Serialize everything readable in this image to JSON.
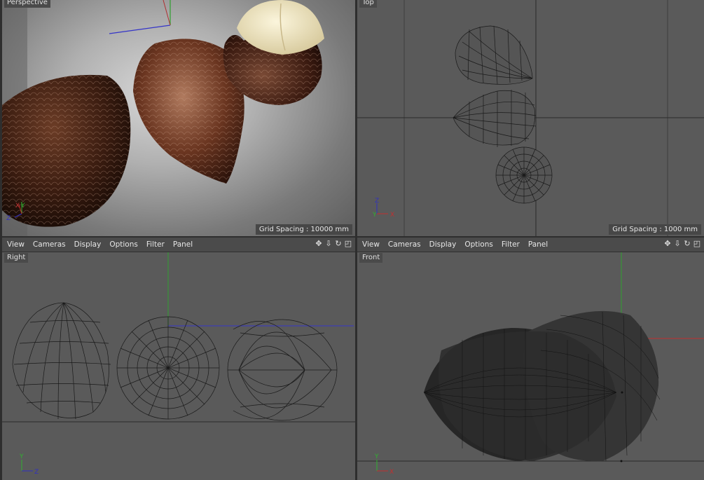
{
  "viewports": {
    "perspective": {
      "label": "Perspective",
      "grid_spacing": "Grid Spacing : 10000 mm"
    },
    "top": {
      "label": "Top",
      "grid_spacing": "Grid Spacing : 1000 mm"
    },
    "right": {
      "label": "Right"
    },
    "front": {
      "label": "Front"
    }
  },
  "menubar": {
    "items": [
      "View",
      "Cameras",
      "Display",
      "Options",
      "Filter",
      "Panel"
    ]
  },
  "axis_labels": {
    "x": "X",
    "y": "Y",
    "z": "Z"
  },
  "nav_icons": [
    "move-icon",
    "dolly-icon",
    "rotate-icon",
    "maximize-icon"
  ],
  "colors": {
    "viewport_bg": "#5a5a5a",
    "menubar_bg": "#4b4b4b",
    "axis_x": "#c03030",
    "axis_y": "#30b030",
    "axis_z": "#3030c0",
    "wire": "#1a1a1a"
  }
}
